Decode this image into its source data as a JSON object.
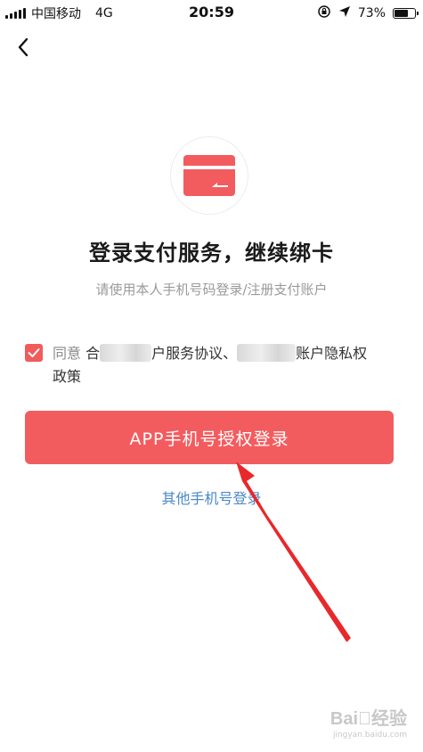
{
  "status_bar": {
    "carrier": "中国移动",
    "network": "4G",
    "time": "20:59",
    "battery_percent_label": "73%",
    "battery_level": 0.73
  },
  "page": {
    "title": "登录支付服务，继续绑卡",
    "subtitle": "请使用本人手机号码登录/注册支付账户"
  },
  "agreement": {
    "checked": true,
    "prefix": "同意",
    "visible_fragment": "合",
    "terms_1_suffix": "户服务协议、",
    "terms_2_suffix": "账户隐私权",
    "terms_2_continued": "政策"
  },
  "actions": {
    "primary_login_label": "APP手机号授权登录",
    "other_login_label": "其他手机号登录"
  },
  "watermark": {
    "brand": "Bai⃝经验",
    "url": "jingyan.baidu.com"
  },
  "colors": {
    "accent_red": "#f35c5f",
    "link_blue": "#4a89c5",
    "subtitle_gray": "#9a9a9a"
  },
  "icons": {
    "back": "chevron-left-icon",
    "card": "bank-card-icon",
    "check": "check-icon",
    "signal": "signal-icon",
    "lock_rotation": "rotation-lock-icon",
    "location": "location-arrow-icon",
    "battery": "battery-icon"
  }
}
